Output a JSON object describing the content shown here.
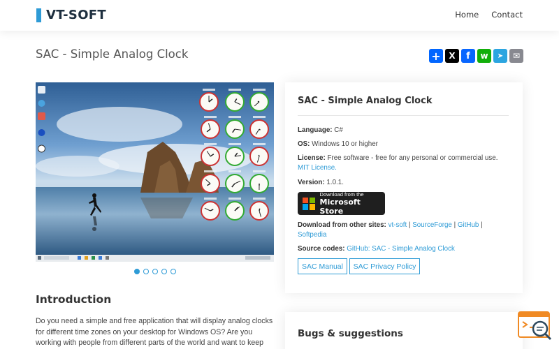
{
  "header": {
    "logo": "VT-SOFT",
    "nav": [
      {
        "label": "Home"
      },
      {
        "label": "Contact"
      }
    ]
  },
  "page": {
    "title": "SAC - Simple Analog Clock"
  },
  "share": {
    "buttons": [
      {
        "name": "share",
        "glyph": "+",
        "color": "#0166ff"
      },
      {
        "name": "x",
        "glyph": "X",
        "color": "#000000"
      },
      {
        "name": "facebook",
        "glyph": "f",
        "color": "#0866ff"
      },
      {
        "name": "whatsapp",
        "glyph": "w",
        "color": "#12af0a"
      },
      {
        "name": "telegram",
        "glyph": "➤",
        "color": "#2ca5e0"
      },
      {
        "name": "email",
        "glyph": "✉",
        "color": "#888990"
      }
    ]
  },
  "carousel": {
    "slide_count": 5,
    "active_index": 0
  },
  "info_card": {
    "title": "SAC - Simple Analog Clock",
    "language_label": "Language:",
    "language_value": "C#",
    "os_label": "OS:",
    "os_value": "Windows 10 or higher",
    "license_label": "License:",
    "license_value": "Free software - free for any personal or commercial use.",
    "license_link": "MIT License.",
    "version_label": "Version:",
    "version_value": "1.0.1.",
    "store_small": "Download from the",
    "store_big": "Microsoft Store",
    "download_label": "Download from other sites:",
    "download_links": [
      "vt-soft",
      "SourceForge",
      "GitHub",
      "Softpedia"
    ],
    "source_label": "Source codes:",
    "source_link": "GitHub: SAC - Simple Analog Clock",
    "manual_button": "SAC Manual",
    "privacy_button": "SAC Privacy Policy"
  },
  "intro": {
    "title": "Introduction",
    "text": "Do you need a simple and free application that will display analog clocks for different time zones on your desktop for Windows OS? Are you working with people from different parts of the world and want to keep"
  },
  "bugs_card": {
    "title": "Bugs & suggestions"
  },
  "colors": {
    "accent": "#2e9bd6",
    "heading": "#333333",
    "text": "#444444"
  }
}
